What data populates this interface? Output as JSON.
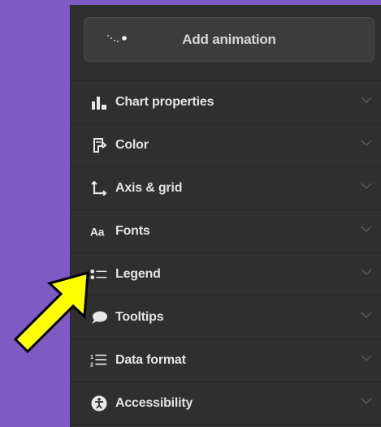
{
  "add_animation": {
    "label": "Add animation",
    "icon": "animation-sparkle-icon"
  },
  "sections": [
    {
      "key": "chart-properties",
      "label": "Chart properties",
      "icon": "bar-chart-icon"
    },
    {
      "key": "color",
      "label": "Color",
      "icon": "paint-bucket-icon"
    },
    {
      "key": "axis-grid",
      "label": "Axis & grid",
      "icon": "axis-icon"
    },
    {
      "key": "fonts",
      "label": "Fonts",
      "icon": "font-aa-icon"
    },
    {
      "key": "legend",
      "label": "Legend",
      "icon": "legend-list-icon"
    },
    {
      "key": "tooltips",
      "label": "Tooltips",
      "icon": "speech-bubble-icon"
    },
    {
      "key": "data-format",
      "label": "Data format",
      "icon": "numbered-list-icon"
    },
    {
      "key": "accessibility",
      "label": "Accessibility",
      "icon": "accessibility-icon"
    }
  ],
  "colors": {
    "background": "#7e5bc4",
    "panel": "#2f2f2f",
    "button": "#3c3c3c",
    "text": "#e2e2e2",
    "annotation_arrow": "#ffff00"
  },
  "annotation": {
    "type": "arrow",
    "points_to": "legend"
  }
}
